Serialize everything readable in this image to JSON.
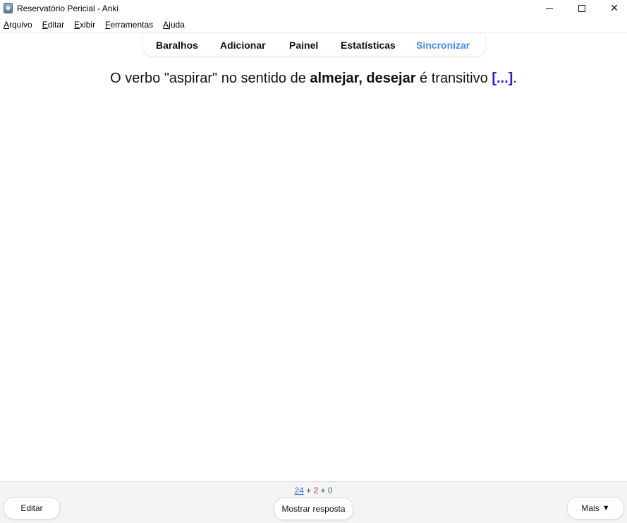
{
  "window": {
    "title": "Reservatório Pericial - Anki",
    "icons": {
      "app": "anki-app-icon",
      "minimize": "minimize-icon",
      "maximize": "maximize-icon",
      "close": "close-icon"
    }
  },
  "menubar": {
    "items": [
      {
        "accel": "A",
        "rest": "rquivo"
      },
      {
        "accel": "E",
        "rest": "ditar"
      },
      {
        "accel": "E",
        "rest": "xibir"
      },
      {
        "accel": "F",
        "rest": "erramentas"
      },
      {
        "accel": "A",
        "rest": "juda"
      }
    ]
  },
  "toolbar": {
    "tabs": [
      "Baralhos",
      "Adicionar",
      "Painel",
      "Estatísticas",
      "Sincronizar"
    ],
    "active_tab": "Sincronizar",
    "active_color": "#4a8ae8"
  },
  "card": {
    "text_before": "O verbo \"aspirar\" no sentido de ",
    "bold_text": "almejar, desejar",
    "text_middle": " é transitivo ",
    "cloze": "[...]",
    "text_after": ".",
    "cloze_color": "#1a1aff"
  },
  "bottom": {
    "counts": {
      "new": "24",
      "learning": "2",
      "review": "0",
      "separator": "+"
    },
    "count_colors": {
      "new": "#3a6fd6",
      "learning": "#c4362c",
      "review": "#2f8a3a"
    },
    "edit_label": "Editar",
    "show_answer_label": "Mostrar resposta",
    "more_label": "Mais",
    "more_icon": "triangle-down-icon"
  }
}
